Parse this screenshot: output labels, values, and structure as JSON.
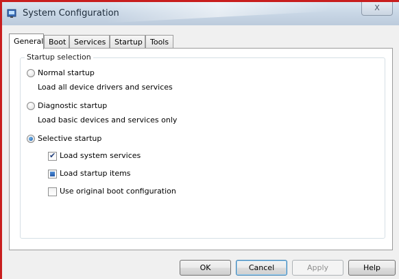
{
  "window": {
    "title": "System Configuration",
    "close_label": "X"
  },
  "tabs": [
    {
      "label": "General",
      "active": true
    },
    {
      "label": "Boot",
      "active": false
    },
    {
      "label": "Services",
      "active": false
    },
    {
      "label": "Startup",
      "active": false
    },
    {
      "label": "Tools",
      "active": false
    }
  ],
  "startup_selection": {
    "group_label": "Startup selection",
    "normal": {
      "label": "Normal startup",
      "description": "Load all device drivers and services",
      "selected": false
    },
    "diagnostic": {
      "label": "Diagnostic startup",
      "description": "Load basic devices and services only",
      "selected": false
    },
    "selective": {
      "label": "Selective startup",
      "selected": true
    },
    "options": {
      "load_system_services": {
        "label": "Load system services",
        "state": "checked"
      },
      "load_startup_items": {
        "label": "Load startup items",
        "state": "indeterminate"
      },
      "use_original_boot": {
        "label": "Use original boot configuration",
        "state": "unchecked"
      }
    }
  },
  "buttons": {
    "ok": "OK",
    "cancel": "Cancel",
    "apply": "Apply",
    "help": "Help"
  },
  "colors": {
    "accent_border": "#c81e1e",
    "radio_fill": "#1d5fa8"
  }
}
